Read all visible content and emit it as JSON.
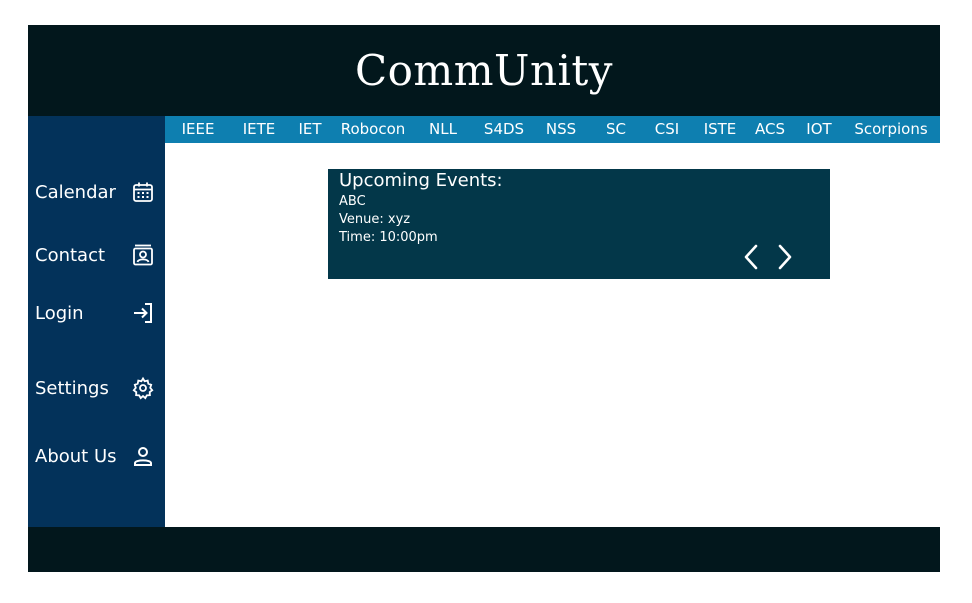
{
  "header": {
    "title": "CommUnity"
  },
  "nav": {
    "items": [
      "IEEE",
      "IETE",
      "IET",
      "Robocon",
      "NLL",
      "S4DS",
      "NSS",
      "SC",
      "CSI",
      "ISTE",
      "ACS",
      "IOT",
      "Scorpions"
    ]
  },
  "sidebar": {
    "items": [
      {
        "label": "Calendar",
        "icon": "calendar-icon"
      },
      {
        "label": "Contact",
        "icon": "contact-icon"
      },
      {
        "label": "Login",
        "icon": "login-icon"
      },
      {
        "label": "Settings",
        "icon": "gear-icon"
      },
      {
        "label": "About Us",
        "icon": "user-icon"
      }
    ]
  },
  "events": {
    "title": "Upcoming Events:",
    "name": "ABC",
    "venue": "Venue: xyz",
    "time": "Time: 10:00pm"
  },
  "colors": {
    "header_bg": "#02171c",
    "sidebar_bg": "#03325a",
    "nav_bg": "#0e7fb0",
    "events_bg": "#033749",
    "footer_bg": "#02171c"
  }
}
